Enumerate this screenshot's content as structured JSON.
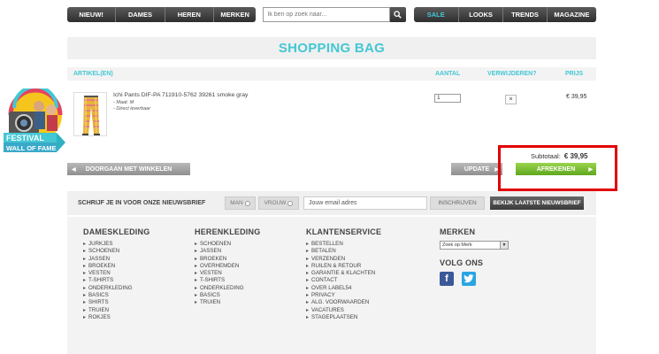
{
  "nav": {
    "left": [
      "NIEUW!",
      "DAMES",
      "HEREN",
      "MERKEN"
    ],
    "search_placeholder": "Ik ben op zoek naar...",
    "right": [
      "SALE",
      "LOOKS",
      "TRENDS",
      "MAGAZINE"
    ]
  },
  "page_title": "SHOPPING BAG",
  "table_headers": {
    "article": "ARTIKEL(EN)",
    "quantity": "AANTAL",
    "remove": "VERWIJDEREN?",
    "price": "PRIJS"
  },
  "product": {
    "name": "Ichi Pants DIF-PA 711910-5762 39261 smoke gray",
    "size": "- Maat: M",
    "availability": "- Direct leverbaar",
    "quantity": "1",
    "remove_symbol": "×",
    "price": "€ 39,95"
  },
  "badge": {
    "line1": "FESTIVAL",
    "line2": "WALL OF FAME"
  },
  "subtotal": {
    "label": "Subtotaal:",
    "value": "€ 39,95"
  },
  "actions": {
    "continue": "DOORGAAN MET WINKELEN",
    "update": "UPDATE",
    "checkout": "AFREKENEN"
  },
  "newsletter": {
    "label": "SCHRIJF JE IN VOOR ONZE NIEUWSBRIEF",
    "man": "MAN",
    "woman": "VROUW",
    "email_placeholder": "Jouw email adres",
    "subscribe": "INSCHRIJVEN",
    "view_latest": "BEKIJK LAATSTE NIEUWSBRIEF"
  },
  "footer": {
    "dames": {
      "title": "DAMESKLEDING",
      "items": [
        "JURKJES",
        "SCHOENEN",
        "JASSEN",
        "BROEKEN",
        "VESTEN",
        "T-SHIRTS",
        "ONDERKLEDING",
        "BASICS",
        "SHIRTS",
        "TRUIEN",
        "ROKJES"
      ]
    },
    "heren": {
      "title": "HERENKLEDING",
      "items": [
        "SCHOENEN",
        "JASSEN",
        "BROEKEN",
        "OVERHEMDEN",
        "VESTEN",
        "T-SHIRTS",
        "ONDERKLEDING",
        "BASICS",
        "TRUIEN"
      ]
    },
    "service": {
      "title": "KLANTENSERVICE",
      "items": [
        "BESTELLEN",
        "BETALEN",
        "VERZENDEN",
        "RUILEN & RETOUR",
        "GARANTIE & KLACHTEN",
        "CONTACT",
        "OVER LABEL54",
        "PRIVACY",
        "ALG. VOORWAARDEN",
        "VACATURES",
        "STAGEPLAATSEN"
      ]
    },
    "merken": {
      "title": "MERKEN",
      "select": "Zoek op Merk"
    },
    "volg": {
      "title": "VOLG ONS",
      "facebook": "f"
    }
  },
  "colors": {
    "accent": "#43c7d4",
    "checkout_green": "#7cc13a",
    "highlight_red": "#e10000"
  }
}
